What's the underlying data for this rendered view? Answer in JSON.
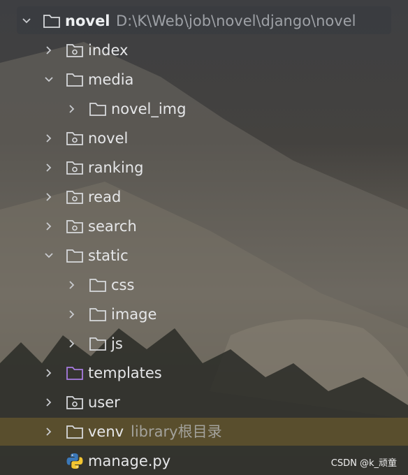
{
  "project": {
    "name": "novel",
    "path": "D:\\K\\Web\\job\\novel\\django\\novel"
  },
  "tree": [
    {
      "label": "index",
      "type": "package",
      "state": "collapsed"
    },
    {
      "label": "media",
      "type": "folder",
      "state": "expanded"
    },
    {
      "label": "novel_img",
      "type": "folder",
      "state": "collapsed"
    },
    {
      "label": "novel",
      "type": "package",
      "state": "collapsed"
    },
    {
      "label": "ranking",
      "type": "package",
      "state": "collapsed"
    },
    {
      "label": "read",
      "type": "package",
      "state": "collapsed"
    },
    {
      "label": "search",
      "type": "package",
      "state": "collapsed"
    },
    {
      "label": "static",
      "type": "folder",
      "state": "expanded"
    },
    {
      "label": "css",
      "type": "folder",
      "state": "collapsed"
    },
    {
      "label": "image",
      "type": "folder",
      "state": "collapsed"
    },
    {
      "label": "js",
      "type": "folder",
      "state": "collapsed"
    },
    {
      "label": "templates",
      "type": "templates-folder",
      "state": "collapsed"
    },
    {
      "label": "user",
      "type": "package",
      "state": "collapsed"
    },
    {
      "label": "venv",
      "type": "folder",
      "state": "collapsed",
      "hint": "library根目录"
    },
    {
      "label": "manage.py",
      "type": "python-file",
      "state": "leaf"
    }
  ],
  "watermark": "CSDN @k_顽童",
  "colors": {
    "text": "#e6e7e9",
    "path_text": "#9ea1a6",
    "templates_folder": "#a77be0",
    "python_blue": "#3b78b8",
    "python_yellow": "#f2c531",
    "venv_highlight": "#7a6430"
  }
}
